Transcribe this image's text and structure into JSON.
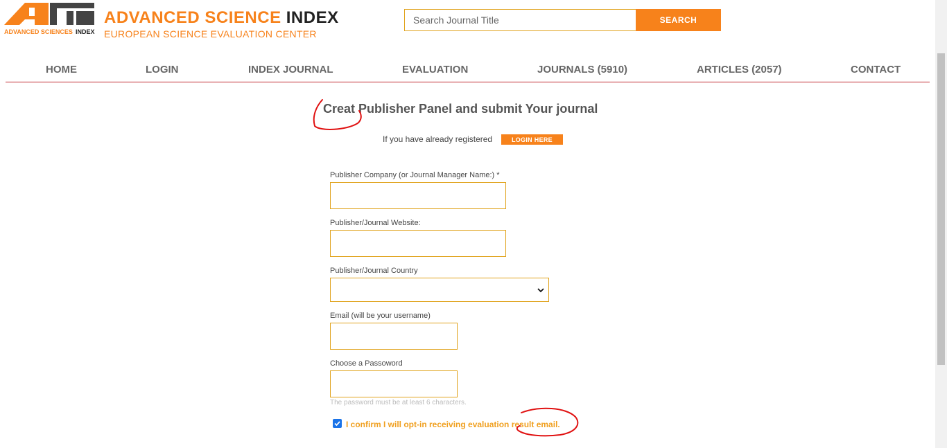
{
  "header": {
    "logo_text_1": "ADVANCED SCIENCES",
    "logo_text_2": "INDEX",
    "brand_orange": "ADVANCED SCIENCE",
    "brand_dark": "INDEX",
    "subtitle": "EUROPEAN SCIENCE EVALUATION CENTER",
    "search_placeholder": "Search Journal Title",
    "search_label": "SEARCH"
  },
  "nav": {
    "items": [
      "HOME",
      "LOGIN",
      "INDEX JOURNAL",
      "EVALUATION",
      "JOURNALS (5910)",
      "ARTICLES (2057)",
      "CONTACT"
    ]
  },
  "main": {
    "title": "Creat Publisher Panel and submit Your journal",
    "already_text": "If you have already registered",
    "login_here": "LOGIN HERE",
    "company_label": "Publisher Company (or Journal Manager Name:) *",
    "website_label": "Publisher/Journal Website:",
    "country_label": "Publisher/Journal Country",
    "email_label": "Email (will be your username)",
    "password_label": "Choose a Passoword",
    "password_help": "The password must be at least 6 characters.",
    "confirm_label": "I confirm I will opt-in receiving evaluation result email.",
    "confirm_checked": true
  },
  "colors": {
    "accent": "#f7821b",
    "nav_line": "#c0272d",
    "input_border": "#e0a21a",
    "annotation": "#e01010"
  }
}
